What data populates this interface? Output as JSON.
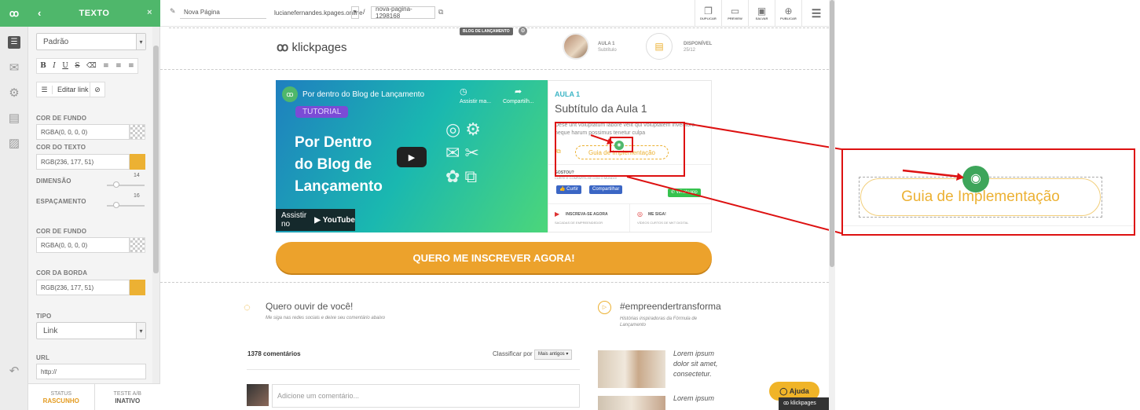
{
  "panel": {
    "title": "TEXTO",
    "font_select": "Padrão",
    "format_buttons": [
      "B",
      "I",
      "U",
      "S",
      "⌫",
      "≡",
      "≡",
      "≡"
    ],
    "edit_link": "Editar link",
    "cor_de_fundo_label": "COR DE FUNDO",
    "cor_de_fundo_value": "RGBA(0, 0, 0, 0)",
    "cor_do_texto_label": "COR DO TEXTO",
    "cor_do_texto_value": "RGB(236, 177, 51)",
    "dimensao_label": "DIMENSÃO",
    "dimensao_value": "14",
    "espacamento_label": "ESPAÇAMENTO",
    "espacamento_value": "16",
    "cor_de_fundo2_label": "COR DE FUNDO",
    "cor_de_fundo2_value": "RGBA(0, 0, 0, 0)",
    "cor_da_borda_label": "COR DA BORDA",
    "cor_da_borda_value": "RGB(236, 177, 51)",
    "tipo_label": "TIPO",
    "tipo_value": "Link",
    "url_label": "URL",
    "url_value": "http://",
    "footer_status_label": "STATUS",
    "footer_status_value": "RASCUNHO",
    "footer_test_label": "TESTE A/B",
    "footer_test_value": "INATIVO"
  },
  "topbar": {
    "page_name": "Nova Página",
    "domain": "lucianefernandes.kpages.online",
    "slug_sep": "/",
    "slug": "nova-pagina-1298168",
    "actions": [
      "DUPLICAR",
      "PREVIEW",
      "SALVAR",
      "PUBLICAR"
    ]
  },
  "page": {
    "badge": "BLOG DE LANÇAMENTO",
    "logo": "klickpages",
    "aula_title": "AULA 1",
    "aula_sub": "Subtítulo",
    "disponivel_title": "DISPONÍVEL",
    "disponivel_date": "25/12",
    "video_title": "Por dentro do Blog de Lançamento",
    "video_watch_later": "Assistir ma...",
    "video_share": "Compartilh...",
    "video_tag": "TUTORIAL",
    "video_big_line1": "Por Dentro",
    "video_big_line2": "do Blog de",
    "video_big_line3": "Lançamento",
    "video_watch_on": "Assistir no",
    "video_youtube": "YouTube",
    "card_aula": "AULA 1",
    "card_subtitle": "Subtítulo da Aula 1",
    "card_desc": "Dese unt voluptatum labore velit qui voluptatem inventore neque harum possimus tenetur culpa",
    "card_button": "Guia de Implementação",
    "share_label": "GOSTOU?",
    "share_sub": "CURTE E COMPARTILHE COM O MUNDO!",
    "curtir": "Curtir",
    "compartilhar": "Compartilhar",
    "whatsapp": "Whatsapp",
    "inscreva_title": "INSCREVA-SE AGORA",
    "inscreva_sub": "SACADAS DE EMPREENDEDOR",
    "siga_title": "ME SIGA!",
    "siga_sub": "VÍDEOS CURTOS DE MKT DIGITAL",
    "cta": "QUERO ME INSCREVER AGORA!",
    "comment_title": "Quero ouvir de você!",
    "comment_sub": "Me siga nas redes sociais e deixe seu comentário abaixo",
    "comments_count": "1378 comentários",
    "sort_label": "Classificar por",
    "sort_value": "Mais antigos",
    "comment_placeholder": "Adicione um comentário...",
    "side_title": "#empreendertransforma",
    "side_sub": "Histórias inspiradoras da Fórmula de Lançamento",
    "lorem1": "Lorem ipsum dolor sit amet, consectetur.",
    "lorem2": "Lorem ipsum",
    "help": "Ajuda",
    "watermark": "klickpages"
  },
  "zoom": {
    "button": "Guia de Implementação"
  },
  "colors": {
    "green": "#4fb76b",
    "orange": "#ecb133",
    "cta": "#eca22c",
    "red": "#d11111",
    "teal": "#3fb6c6"
  }
}
